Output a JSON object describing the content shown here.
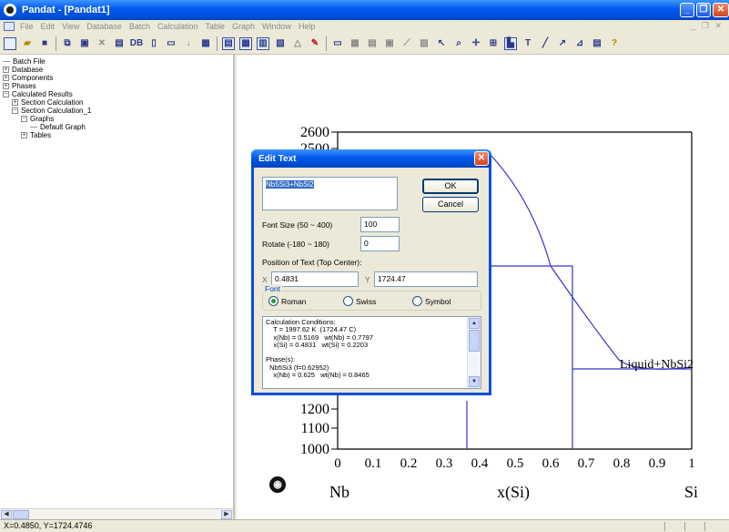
{
  "window": {
    "title": "Pandat - [Pandat1]"
  },
  "menu": [
    "File",
    "Edit",
    "View",
    "Database",
    "Batch",
    "Calculation",
    "Table",
    "Graph",
    "Window",
    "Help"
  ],
  "tree": {
    "batch_file": "Batch File",
    "database": "Database",
    "components": "Components",
    "phases": "Phases",
    "calculated_results": "Calculated Results",
    "section_calculation": "Section Calculation",
    "section_calculation_1": "Section Calculation_1",
    "graphs": "Graphs",
    "default_graph": "Default Graph",
    "tables": "Tables"
  },
  "graph": {
    "y_ticks_visible": [
      "2600",
      "2500",
      "1200",
      "1100",
      "1000"
    ],
    "x_ticks": [
      "0",
      "0.1",
      "0.2",
      "0.3",
      "0.4",
      "0.5",
      "0.6",
      "0.7",
      "0.8",
      "0.9",
      "1"
    ],
    "x_left_label": "Nb",
    "x_axis_title": "x(Si)",
    "x_right_label": "Si",
    "region_label": "Liquid+NbSi2"
  },
  "dialog": {
    "title": "Edit Text",
    "text_value": "Nb5Si3+NbSi2",
    "ok_label": "OK",
    "cancel_label": "Cancel",
    "font_size_label": "Font Size (50 ~ 400)",
    "font_size_value": "100",
    "rotate_label": "Rotate (-180 ~ 180)",
    "rotate_value": "0",
    "position_label": "Position of Text (Top Center):",
    "x_label": "X",
    "x_value": "0.4831",
    "y_label": "Y",
    "y_value": "1724.47",
    "font_group_label": "Font",
    "font_options": [
      "Roman",
      "Swiss",
      "Symbol"
    ],
    "font_selected": "Roman",
    "conditions_text": "Calculation Conditions:\n    T = 1997.62 K  (1724.47 C)\n    x(Nb) = 0.5169   wt(Nb) = 0.7797\n    x(Si) = 0.4831   wt(Si) = 0.2203\n\nPhase(s):\n  Nb5Si3 (f=0.62952)\n    x(Nb) = 0.625   wt(Nb) = 0.8465"
  },
  "status": {
    "coords": "X=0.4850, Y=1724.4746"
  }
}
